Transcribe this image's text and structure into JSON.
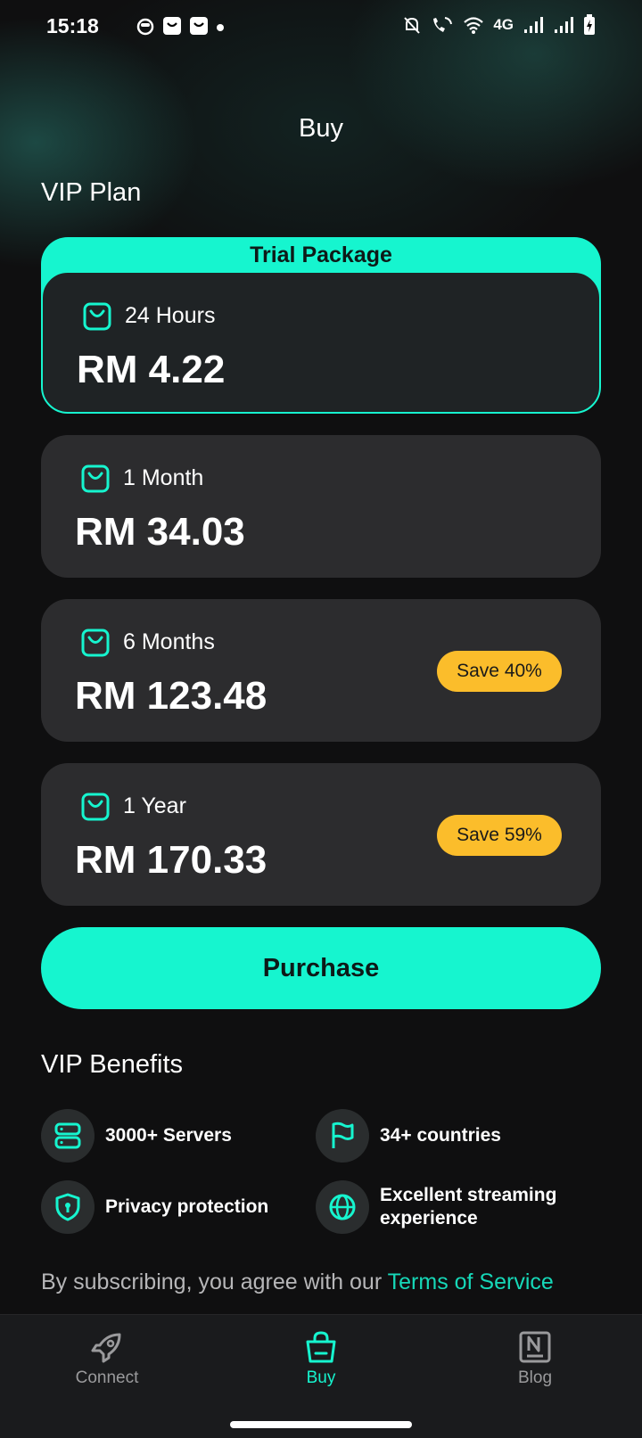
{
  "status_bar": {
    "time": "15:18",
    "network": "4G"
  },
  "header": {
    "title": "Buy"
  },
  "vip_plan": {
    "title": "VIP Plan",
    "trial_label": "Trial Package",
    "plans": [
      {
        "duration": "24 Hours",
        "price": "RM 4.22",
        "save": "",
        "selected": true
      },
      {
        "duration": "1 Month",
        "price": "RM 34.03",
        "save": ""
      },
      {
        "duration": "6 Months",
        "price": "RM 123.48",
        "save": "Save 40%"
      },
      {
        "duration": "1 Year",
        "price": "RM 170.33",
        "save": "Save 59%"
      }
    ]
  },
  "purchase": {
    "label": "Purchase"
  },
  "benefits": {
    "title": "VIP Benefits",
    "items": [
      {
        "label": "3000+ Servers",
        "icon": "server-icon"
      },
      {
        "label": "34+ countries",
        "icon": "flag-icon"
      },
      {
        "label": "Privacy protection",
        "icon": "shield-icon"
      },
      {
        "label": "Excellent streaming experience",
        "icon": "globe-icon"
      }
    ]
  },
  "terms": {
    "prefix": "By subscribing, you agree with our ",
    "link": "Terms of Service"
  },
  "bottom_nav": {
    "items": [
      {
        "label": "Connect",
        "icon": "rocket-icon"
      },
      {
        "label": "Buy",
        "icon": "shopping-bag-icon",
        "active": true
      },
      {
        "label": "Blog",
        "icon": "blog-icon"
      }
    ]
  },
  "colors": {
    "accent": "#16f5cf",
    "badge": "#fbbd2b",
    "card": "#2c2c2e",
    "background": "#0f0f10"
  }
}
